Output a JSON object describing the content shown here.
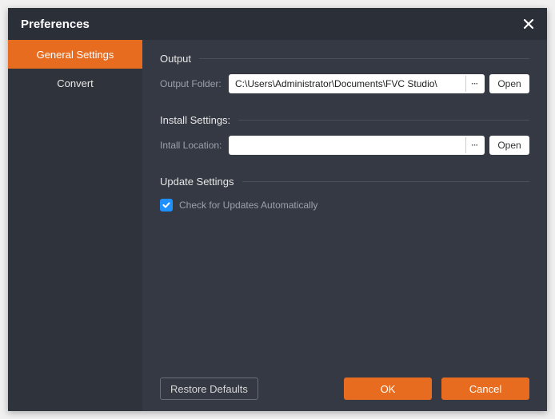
{
  "titlebar": {
    "title": "Preferences"
  },
  "sidebar": {
    "items": [
      {
        "label": "General Settings",
        "active": true
      },
      {
        "label": "Convert",
        "active": false
      }
    ]
  },
  "sections": {
    "output": {
      "heading": "Output",
      "folder_label": "Output Folder:",
      "folder_value": "C:\\Users\\Administrator\\Documents\\FVC Studio\\",
      "browse_label": "···",
      "open_label": "Open"
    },
    "install": {
      "heading": "Install Settings:",
      "location_label": "Intall Location:",
      "location_value": "",
      "browse_label": "···",
      "open_label": "Open"
    },
    "update": {
      "heading": "Update Settings",
      "checkbox_label": "Check for Updates Automatically",
      "checked": true
    }
  },
  "footer": {
    "restore_label": "Restore Defaults",
    "ok_label": "OK",
    "cancel_label": "Cancel"
  },
  "colors": {
    "accent": "#e86c1f",
    "checkbox": "#1e90ff"
  }
}
